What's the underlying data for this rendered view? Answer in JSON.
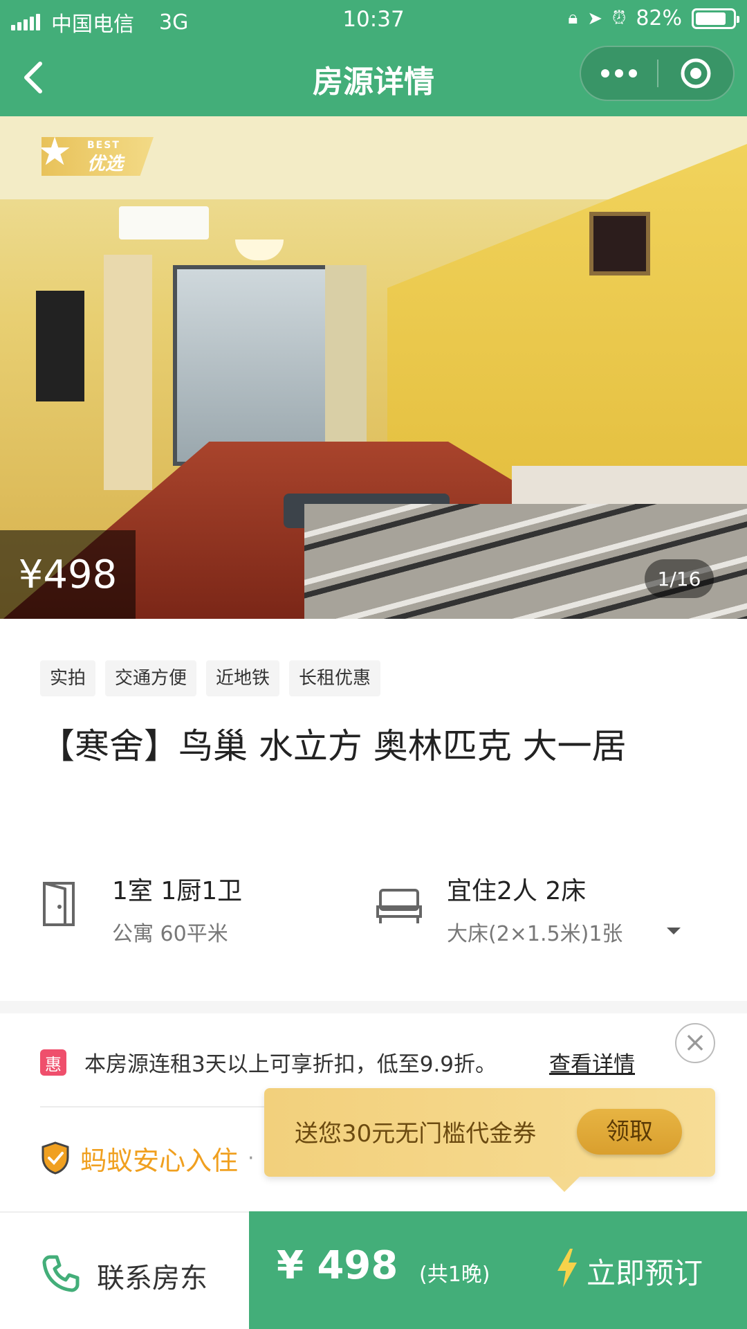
{
  "status_bar": {
    "carrier": "中国电信",
    "network": "3G",
    "time": "10:37",
    "battery": "82%",
    "battery_level": 0.82
  },
  "nav": {
    "title": "房源详情",
    "back_icon": "chevron-left-icon",
    "more_icon": "more-dots-icon",
    "close_icon": "target-circle-icon"
  },
  "hero": {
    "badge_en": "BEST",
    "badge_cn": "优选",
    "price": "¥498",
    "counter": "1/16"
  },
  "tags": [
    "实拍",
    "交通方便",
    "近地铁",
    "长租优惠"
  ],
  "listing": {
    "title": "【寒舍】鸟巢 水立方 奥林匹克 大一居"
  },
  "specs": {
    "layout_main": "1室 1厨1卫",
    "layout_sub": "公寓 60平米",
    "bed_main": "宜住2人 2床",
    "bed_sub": "大床(2×1.5米)1张"
  },
  "promo": {
    "badge": "惠",
    "text": "本房源连租3天以上可享折扣，低至9.9折。",
    "link": "查看详情"
  },
  "safety": {
    "label": "蚂蚁安心入住",
    "separator": "·"
  },
  "coupon": {
    "text": "送您30元无门槛代金券",
    "button": "领取"
  },
  "bottom": {
    "contact_label": "联系房东",
    "price": "¥ 498",
    "nights": "(共1晚)",
    "book_label": "立即预订"
  },
  "colors": {
    "brand_green": "#43ae79",
    "promo_red": "#ef4f6c",
    "safety_orange": "#f0a020",
    "coupon_gold": "#f2d07c"
  }
}
